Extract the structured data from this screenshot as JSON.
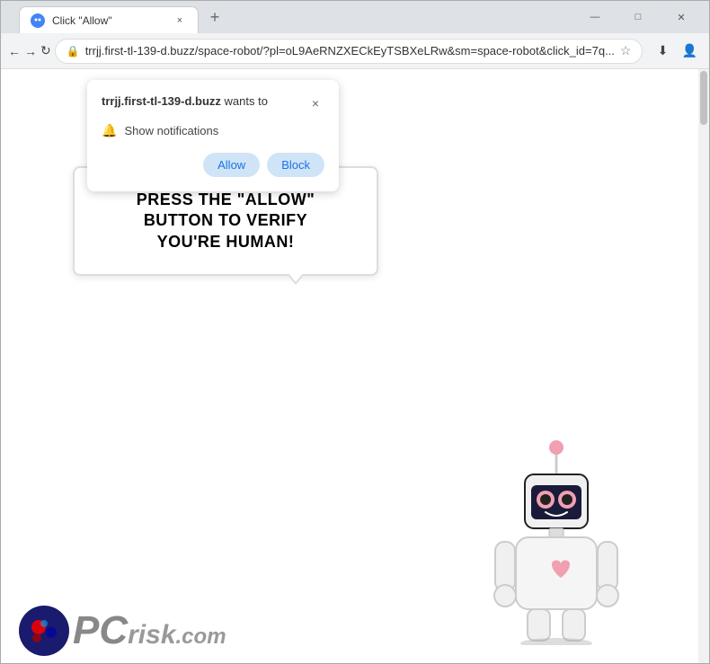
{
  "window": {
    "title": "Click \"Allow\"",
    "tab_favicon": "●",
    "tab_close": "×",
    "new_tab": "+",
    "minimize": "—",
    "maximize": "□",
    "close": "✕"
  },
  "nav": {
    "back_label": "←",
    "forward_label": "→",
    "refresh_label": "↻",
    "url": "trrjj.first-tl-139-d.buzz/space-robot/?pl=oL9AeRNZXECkEyTSBXeLRw&sm=space-robot&click_id=7q...",
    "star_icon": "☆",
    "download_icon": "⬇",
    "profile_icon": "👤",
    "menu_icon": "⋮"
  },
  "notification_popup": {
    "site_name": "trrjj.first-tl-139-d.buzz",
    "wants_to": " wants to",
    "close_icon": "×",
    "bell_icon": "🔔",
    "permission_text": "Show notifications",
    "allow_label": "Allow",
    "block_label": "Block"
  },
  "page": {
    "bubble_text_line1": "PRESS THE \"ALLOW\" BUTTON TO VERIFY",
    "bubble_text_line2": "YOU'RE HUMAN!",
    "pcrisk_logo": "PCrisk.com"
  },
  "colors": {
    "allow_bg": "#d0e4f7",
    "allow_text": "#1a73e8",
    "title_bar_bg": "#dee1e6",
    "nav_bar_bg": "#f1f3f4"
  }
}
